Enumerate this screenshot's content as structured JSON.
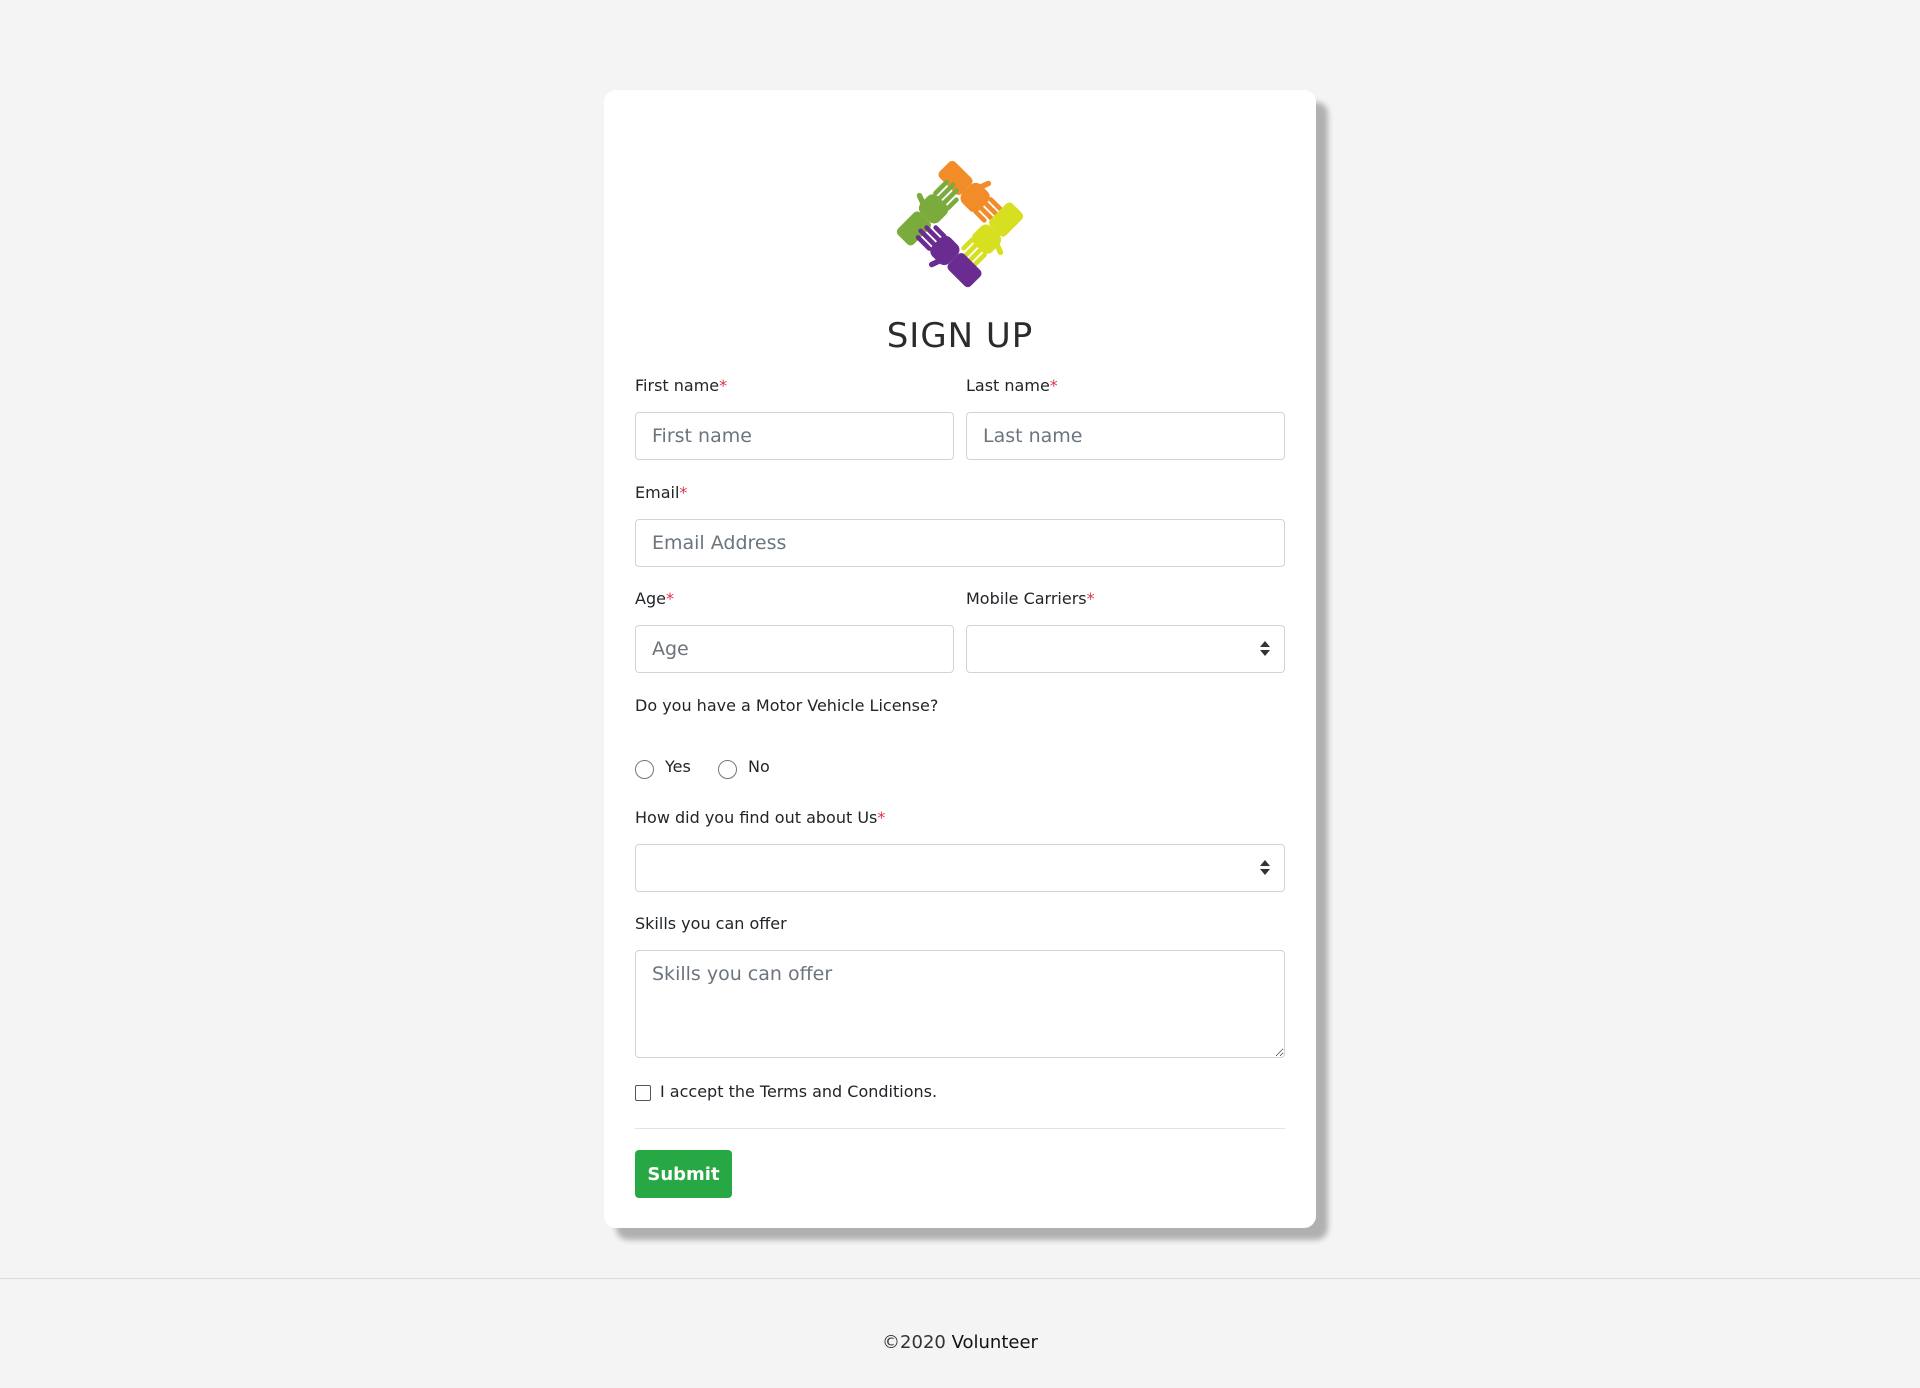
{
  "form": {
    "title": "SIGN UP",
    "required_marker": "*",
    "first_name": {
      "label": "First name",
      "placeholder": "First name"
    },
    "last_name": {
      "label": "Last name",
      "placeholder": "Last name"
    },
    "email": {
      "label": "Email",
      "placeholder": "Email Address"
    },
    "age": {
      "label": "Age",
      "placeholder": "Age"
    },
    "carriers": {
      "label": "Mobile Carriers",
      "selected": ""
    },
    "license": {
      "question": "Do you have a Motor Vehicle License?",
      "options": [
        "Yes",
        "No"
      ]
    },
    "source": {
      "label": "How did you find out about Us",
      "selected": ""
    },
    "skills": {
      "label": "Skills you can offer",
      "placeholder": "Skills you can offer"
    },
    "terms_label": "I accept the Terms and Conditions.",
    "submit_label": "Submit"
  },
  "footer": {
    "copyright": "©2020",
    "brand": "Volunteer"
  },
  "colors": {
    "accent": "#28a745",
    "required": "#e0324b",
    "logo_hands": [
      "#f28c28",
      "#7aab3c",
      "#d6e021",
      "#6a2c91"
    ]
  },
  "icons": {
    "logo": "hands-logo-icon",
    "select": "select-arrows-icon"
  }
}
